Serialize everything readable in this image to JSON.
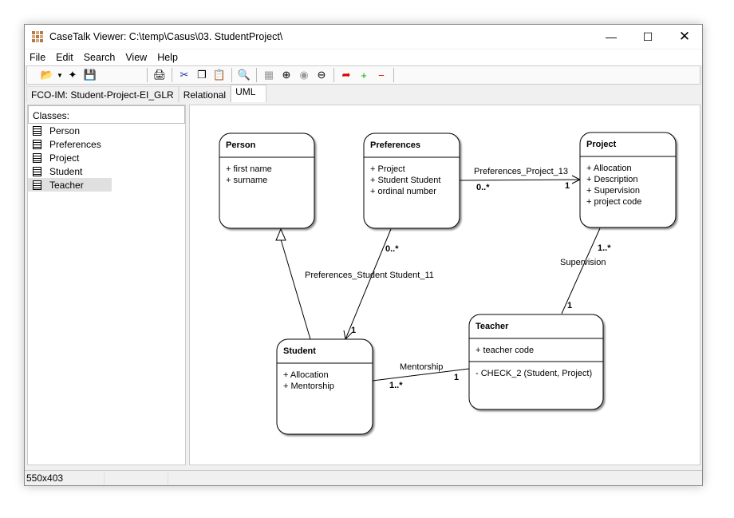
{
  "window": {
    "title": "CaseTalk Viewer: C:\\temp\\Casus\\03. StudentProject\\",
    "controls": [
      "minimize",
      "maximize",
      "close"
    ]
  },
  "menu": [
    "File",
    "Edit",
    "Search",
    "View",
    "Help"
  ],
  "toolbar": [
    "open-folder",
    "dropdown",
    "new-project",
    "save",
    "print",
    "cut",
    "copy",
    "paste",
    "find",
    "grid",
    "zoom-in",
    "zoom-fit",
    "zoom-out",
    "select-pointer",
    "add-point",
    "remove-point"
  ],
  "tabs": [
    {
      "label": "FCO-IM: Student-Project-EI_GLR"
    },
    {
      "label": "Relational"
    },
    {
      "label": "UML",
      "active": true
    }
  ],
  "classes_panel": {
    "header": "Classes:",
    "items": [
      "Person",
      "Preferences",
      "Project",
      "Student",
      "Teacher"
    ],
    "selected": "Teacher"
  },
  "diagram": {
    "classes": [
      {
        "name": "Person",
        "attributes": [
          "+ first name",
          "+ surname"
        ],
        "operations": []
      },
      {
        "name": "Preferences",
        "attributes": [
          "+ Project",
          "+ Student Student",
          "+ ordinal number"
        ],
        "operations": []
      },
      {
        "name": "Project",
        "attributes": [
          "+ Allocation",
          "+ Description",
          "+ Supervision",
          "+ project code"
        ],
        "operations": []
      },
      {
        "name": "Student",
        "attributes": [
          "+ Allocation",
          "+ Mentorship"
        ],
        "operations": []
      },
      {
        "name": "Teacher",
        "attributes": [
          "+ teacher code"
        ],
        "operations": [
          "- CHECK_2 (Student, Project)"
        ]
      }
    ],
    "associations": [
      {
        "label": "Preferences_Project_13",
        "from_mult": "0..*",
        "to_mult": "1"
      },
      {
        "label": "Preferences_Student Student_11",
        "from_mult": "0..*",
        "to_mult": "1"
      },
      {
        "label": "Supervision",
        "from_mult": "1..*",
        "to_mult": "1"
      },
      {
        "label": "Mentorship",
        "from_mult": "1..*",
        "to_mult": "1"
      }
    ]
  },
  "status": {
    "size": "550x403"
  }
}
